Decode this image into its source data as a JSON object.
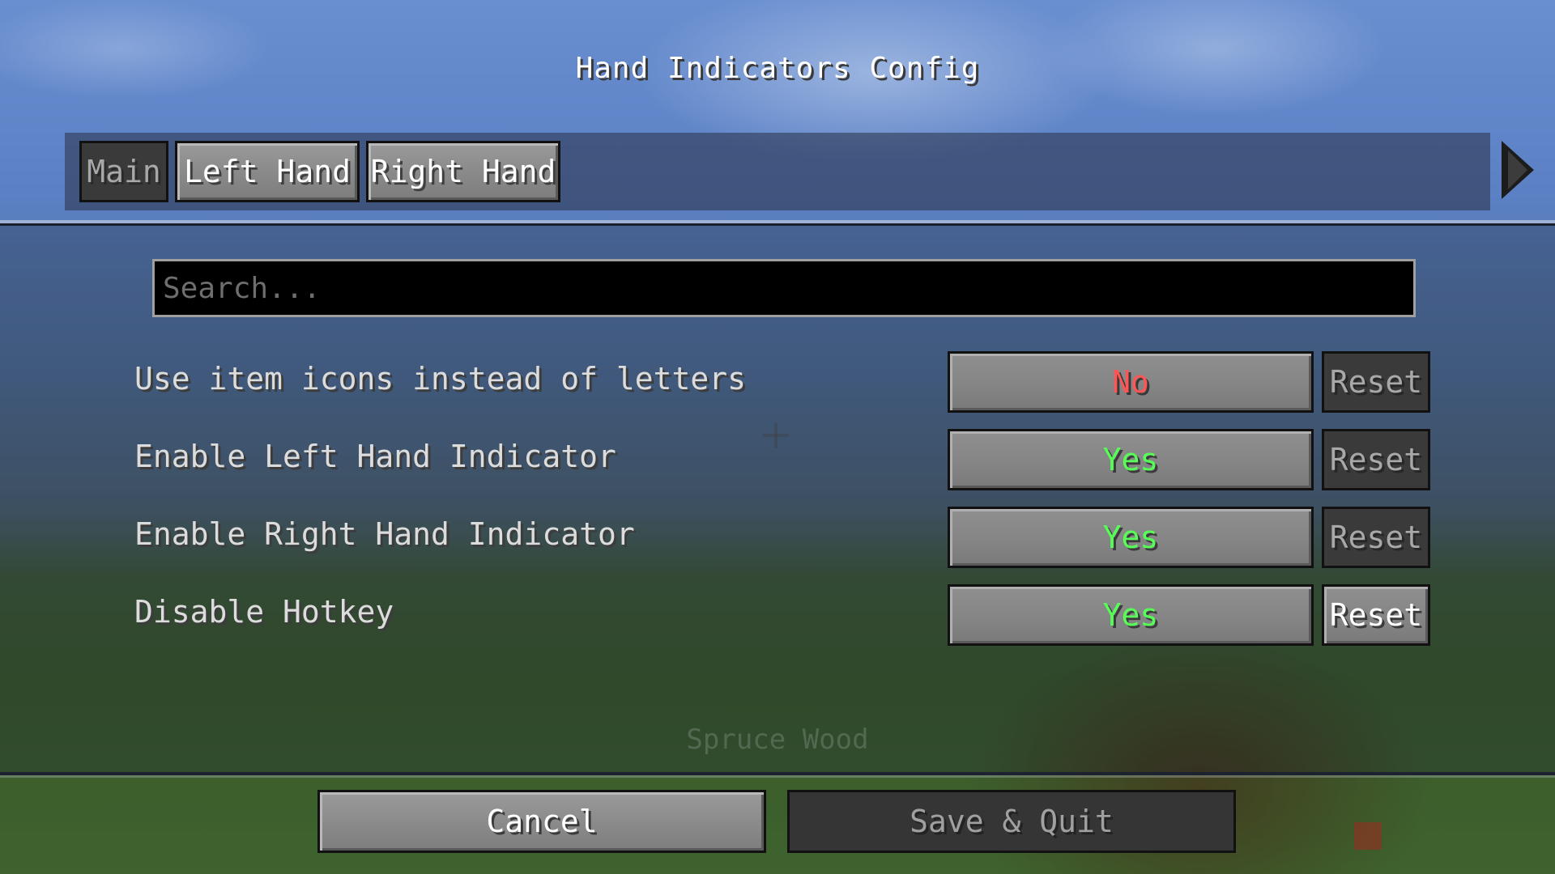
{
  "window": {
    "title": "Hand Indicators Config"
  },
  "tabs": [
    {
      "label": "Main",
      "active": true
    },
    {
      "label": "Left Hand",
      "active": false
    },
    {
      "label": "Right Hand",
      "active": false
    }
  ],
  "search": {
    "placeholder": "Search...",
    "value": ""
  },
  "options": [
    {
      "label": "Use item icons instead of letters",
      "value": "No",
      "value_color": "#ff5555",
      "reset_label": "Reset",
      "reset_enabled": false
    },
    {
      "label": "Enable Left Hand Indicator",
      "value": "Yes",
      "value_color": "#55ff55",
      "reset_label": "Reset",
      "reset_enabled": false
    },
    {
      "label": "Enable Right Hand Indicator",
      "value": "Yes",
      "value_color": "#55ff55",
      "reset_label": "Reset",
      "reset_enabled": false
    },
    {
      "label": "Disable Hotkey",
      "value": "Yes",
      "value_color": "#55ff55",
      "reset_label": "Reset",
      "reset_enabled": true
    }
  ],
  "background_caption": "Spruce Wood",
  "footer": {
    "cancel_label": "Cancel",
    "save_label": "Save & Quit"
  },
  "icons": {
    "next_tab": "right-arrow-icon",
    "crosshair": "crosshair-icon"
  },
  "colors": {
    "yes": "#55ff55",
    "no": "#ff5555"
  }
}
